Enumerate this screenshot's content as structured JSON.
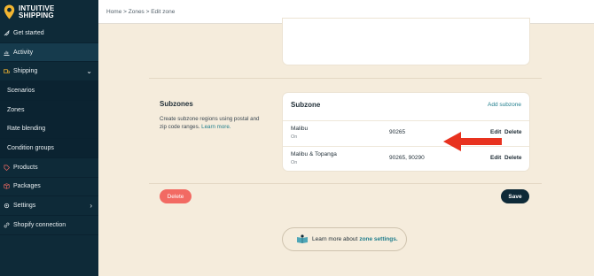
{
  "app": {
    "logo_line1": "INTUITIVE",
    "logo_line2": "SHIPPING"
  },
  "breadcrumb": "Home > Zones > Edit zone",
  "sidebar": {
    "items": [
      {
        "label": "Get started",
        "icon": "rocket-icon"
      },
      {
        "label": "Activity",
        "icon": "activity-icon"
      },
      {
        "label": "Shipping",
        "icon": "truck-icon"
      },
      {
        "label": "Scenarios"
      },
      {
        "label": "Zones"
      },
      {
        "label": "Rate blending"
      },
      {
        "label": "Condition groups"
      },
      {
        "label": "Products",
        "icon": "tag-icon"
      },
      {
        "label": "Packages",
        "icon": "package-icon"
      },
      {
        "label": "Settings",
        "icon": "gear-icon"
      },
      {
        "label": "Shopify connection",
        "icon": "link-icon"
      }
    ]
  },
  "subzones_section": {
    "title": "Subzones",
    "description": "Create subzone regions using postal and zip code ranges.",
    "learn_link": "Learn more."
  },
  "subzone_card": {
    "title": "Subzone",
    "add_label": "Add subzone",
    "rows": [
      {
        "name": "Malibu",
        "status": "On",
        "zips": "90265",
        "edit": "Edit",
        "delete": "Delete"
      },
      {
        "name": "Malibu & Topanga",
        "status": "On",
        "zips": "90265, 90290",
        "edit": "Edit",
        "delete": "Delete"
      }
    ]
  },
  "actions": {
    "delete_label": "Delete",
    "save_label": "Save"
  },
  "learn_more": {
    "prefix": "Learn more about",
    "link": "zone settings."
  },
  "colors": {
    "sidebar_bg": "#0e2a38",
    "page_bg": "#f5ecdc",
    "accent_link": "#1f7d8c",
    "delete_btn": "#f26a63",
    "save_btn": "#0e2a38",
    "arrow": "#e8321f",
    "logo_pin": "#f2b531"
  }
}
